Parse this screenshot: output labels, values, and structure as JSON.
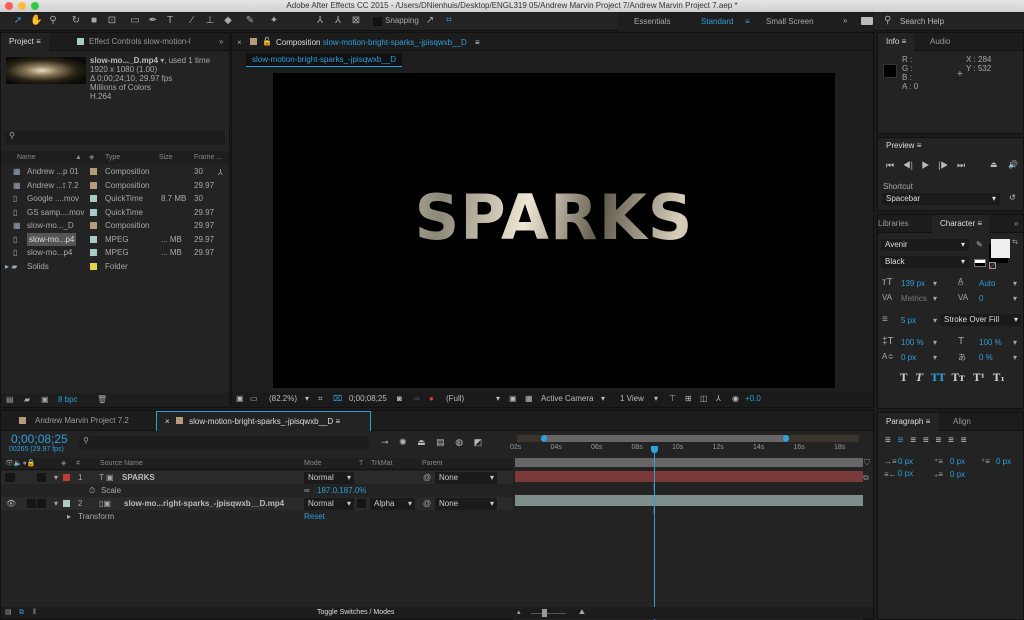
{
  "window": {
    "title": "Adobe After Effects CC 2015 - /Users/DNienhuis/Desktop/ENGL319 05/Andrew Marvin Project 7/Andrew Marvin Project 7.aep *"
  },
  "toolbar": {
    "snapping": "Snapping",
    "workspaces": [
      "Essentials",
      "Standard",
      "Small Screen"
    ],
    "more": "»",
    "search_help": "Search Help"
  },
  "project": {
    "tab": "Project",
    "effect_controls_tab": "Effect Controls slow-motion-l",
    "more": "»",
    "preview": {
      "name": "slow-mo..._D.mp4",
      "used": ", used 1 time",
      "dims": "1920 x 1080 (1.00)",
      "duration": "Δ 0;00;24;10, 29.97 fps",
      "colors": "Millions of Colors",
      "codec": "H.264"
    },
    "columns": [
      "Name",
      "Type",
      "Size",
      "Frame ..."
    ],
    "items": [
      {
        "name": "Andrew ...p 01",
        "type": "Composition",
        "size": "",
        "frame": "30",
        "color": "#b49c7a"
      },
      {
        "name": "Andrew ...t 7.2",
        "type": "Composition",
        "size": "",
        "frame": "29.97",
        "color": "#b49c7a"
      },
      {
        "name": "Google ....mov",
        "type": "QuickTime",
        "size": "8.7 MB",
        "frame": "30",
        "color": "#a7cbc7"
      },
      {
        "name": "GS samp....mov",
        "type": "QuickTime",
        "size": "",
        "frame": "29.97",
        "color": "#a7cbc7"
      },
      {
        "name": "slow-mo..._D",
        "type": "Composition",
        "size": "",
        "frame": "29.97",
        "color": "#b49c7a"
      },
      {
        "name": "slow-mo...p4",
        "type": "MPEG",
        "size": "... MB",
        "frame": "29.97",
        "color": "#a7cbc7",
        "selected": true
      },
      {
        "name": "slow-mo...p4",
        "type": "MPEG",
        "size": "... MB",
        "frame": "29.97",
        "color": "#a7cbc7"
      },
      {
        "name": "Solids",
        "type": "Folder",
        "size": "",
        "frame": "",
        "color": "#e3d24e"
      }
    ],
    "bpc": "8 bpc"
  },
  "composition": {
    "tab_prefix": "Composition",
    "tab_name": "slow-motion-bright-sparks_-jpisqwxb__D",
    "subtab": "slow-motion-bright-sparks_-jpisqwxb__D",
    "text": "SPARKS",
    "footer": {
      "zoom": "(82.2%)",
      "timecode": "0;00;08;25",
      "resolution": "(Full)",
      "camera": "Active Camera",
      "views": "1 View",
      "exposure": "+0.0"
    }
  },
  "info": {
    "tab": "Info",
    "audio_tab": "Audio",
    "r": "R :",
    "g": "G :",
    "b": "B :",
    "a": "A : 0",
    "x": "X : 284",
    "y": "Y : 532"
  },
  "preview": {
    "tab": "Preview",
    "shortcut_label": "Shortcut",
    "shortcut": "Spacebar"
  },
  "character": {
    "libraries_tab": "Libraries",
    "tab": "Character",
    "font": "Avenir",
    "style": "Black",
    "size": "139 px",
    "leading": "Auto",
    "kerning": "Metrics",
    "tracking": "0",
    "stroke": "5 px",
    "stroke_mode": "Stroke Over Fill",
    "vscale": "100 %",
    "hscale": "100 %",
    "baseline": "0 px",
    "tsume": "0 %",
    "styles": [
      "T",
      "T",
      "TT",
      "Tт",
      "T¹",
      "T₁"
    ]
  },
  "paragraph": {
    "tab": "Paragraph",
    "align_tab": "Align",
    "indent_left": "0 px",
    "space_before": "0 px",
    "indent_first": "0 px",
    "indent_right": "0 px",
    "space_after": "0 px"
  },
  "timeline": {
    "tabs": [
      "Andrew Marvin Project 7.2",
      "slow-motion-bright-sparks_-jpisqwxb__D"
    ],
    "timecode": "0;00;08;25",
    "frames": "00265 (29.97 fps)",
    "columns": {
      "num": "#",
      "source": "Source Name",
      "mode": "Mode",
      "t": "T",
      "trkmat": "TrkMat",
      "parent": "Parent"
    },
    "layers": [
      {
        "num": "1",
        "name": "SPARKS",
        "mode": "Normal",
        "trkmat": "",
        "parent": "None",
        "color": "#c23b3b",
        "bar": "#7a3a3a"
      },
      {
        "num": "2",
        "name": "slow-mo...right-sparks_-jpisqwxb__D.mp4",
        "mode": "Normal",
        "trkmat": "Alpha",
        "parent": "None",
        "color": "#a7cbc7",
        "bar": "#7d8e8b"
      }
    ],
    "scale_label": "Scale",
    "scale_value": "187.0,187.0%",
    "transform_label": "Transform",
    "reset": "Reset",
    "ruler": [
      "02s",
      "04s",
      "06s",
      "08s",
      "10s",
      "12s",
      "14s",
      "16s",
      "18s"
    ],
    "toggle": "Toggle Switches / Modes"
  },
  "colors": {
    "accent": "#2d9fd9"
  }
}
